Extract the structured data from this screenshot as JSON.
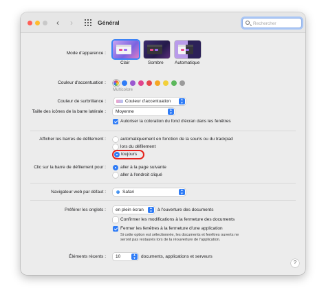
{
  "window": {
    "title": "Général",
    "search_placeholder": "Rechercher"
  },
  "appearance": {
    "label": "Mode d'apparence :",
    "options": [
      "Clair",
      "Sombre",
      "Automatique"
    ],
    "selected": "Clair"
  },
  "accent": {
    "label": "Couleur d'accentuation :",
    "colors": [
      "#c77dff",
      "#2f7cf6",
      "#9b59d0",
      "#e0458e",
      "#e5484d",
      "#f5a623",
      "#f2d03b",
      "#5cb85c",
      "#9b9b9b"
    ],
    "caption": "Multicolore"
  },
  "highlight": {
    "label": "Couleur de surbrillance :",
    "value": "Couleur d'accentuation"
  },
  "sidebar_icons": {
    "label": "Taille des icônes de la barre latérale :",
    "value": "Moyenne"
  },
  "wallpaper_tinting": {
    "label": "Autoriser la coloration du fond d'écran dans les fenêtres",
    "checked": true
  },
  "scrollbars": {
    "label": "Afficher les barres de défilement :",
    "options": [
      "automatiquement en fonction de la souris ou du trackpad",
      "lors du défilement",
      "toujours"
    ],
    "selected": "toujours"
  },
  "click_scrollbar": {
    "label": "Clic sur la barre de défilement pour :",
    "options": [
      "aller à la page suivante",
      "aller à l'endroit cliqué"
    ],
    "selected": "aller à la page suivante"
  },
  "browser": {
    "label": "Navigateur web par défaut :",
    "value": "Safari"
  },
  "tabs": {
    "label": "Préférer les onglets :",
    "value": "en plein écran",
    "suffix": "à l'ouverture des documents"
  },
  "confirm_changes": {
    "label": "Confirmer les modifications à la fermeture des documents",
    "checked": false
  },
  "close_windows": {
    "label": "Fermer les fenêtres à la fermeture d'une application",
    "checked": true,
    "note": "Si cette option est sélectionnée, les documents et fenêtres ouverts ne seront pas restaurés lors de la réouverture de l'application."
  },
  "recent_items": {
    "label": "Éléments récents :",
    "value": "10",
    "suffix": "documents, applications et serveurs"
  },
  "help_label": "?"
}
